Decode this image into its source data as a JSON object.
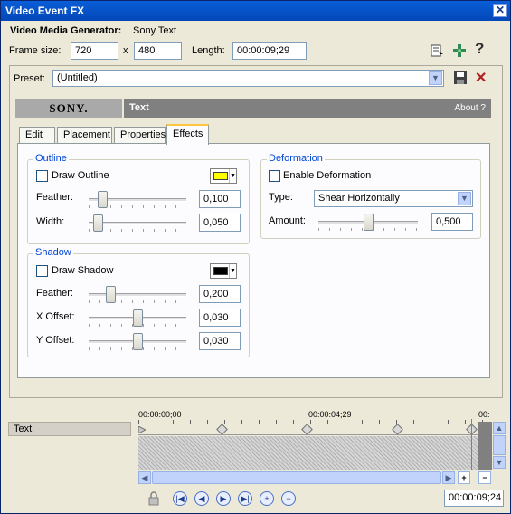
{
  "window": {
    "title": "Video Event FX",
    "close_glyph": "✕"
  },
  "header": {
    "generator_label": "Video Media Generator:",
    "generator_value": "Sony Text",
    "frame_size_label": "Frame size:",
    "width": "720",
    "x_sep": "x",
    "height": "480",
    "length_label": "Length:",
    "length": "00:00:09;29",
    "help_glyph": "?"
  },
  "preset": {
    "label": "Preset:",
    "value": "(Untitled)",
    "delete_glyph": "✕"
  },
  "banner": {
    "logo": "SONY.",
    "title": "Text",
    "about": "About  ?"
  },
  "tabs": [
    {
      "label": "Edit"
    },
    {
      "label": "Placement"
    },
    {
      "label": "Properties"
    },
    {
      "label": "Effects"
    }
  ],
  "outline": {
    "title": "Outline",
    "checkbox_label": "Draw Outline",
    "color": "#ffff00",
    "feather_label": "Feather:",
    "feather_value": "0,100",
    "feather_level": 0.1,
    "width_label": "Width:",
    "width_value": "0,050",
    "width_level": 0.05
  },
  "shadow": {
    "title": "Shadow",
    "checkbox_label": "Draw Shadow",
    "color": "#000000",
    "feather_label": "Feather:",
    "feather_value": "0,200",
    "feather_level": 0.2,
    "xoffset_label": "X Offset:",
    "xoffset_value": "0,030",
    "yoffset_label": "Y Offset:",
    "yoffset_value": "0,030"
  },
  "deformation": {
    "title": "Deformation",
    "checkbox_label": "Enable Deformation",
    "type_label": "Type:",
    "type_value": "Shear Horizontally",
    "amount_label": "Amount:",
    "amount_value": "0,500",
    "amount_level": 0.5
  },
  "timeline": {
    "track_name": "Text",
    "time_start": "00:00:00;00",
    "time_mid": "00:00:04;29",
    "time_end": "00:",
    "cursor_time": "00:00:09;24"
  },
  "colors": {
    "accent": "#0046d5",
    "titlebar": "#0a5ed7",
    "tab_highlight": "#ffc83c"
  },
  "icons": [
    "close-icon",
    "properties-icon",
    "split-icon",
    "help-icon",
    "save-icon",
    "delete-icon",
    "lock-icon",
    "first-keyframe-icon",
    "prev-keyframe-icon",
    "next-keyframe-icon",
    "last-keyframe-icon",
    "add-keyframe-icon",
    "remove-keyframe-icon",
    "zoom-in-icon",
    "zoom-out-icon"
  ]
}
